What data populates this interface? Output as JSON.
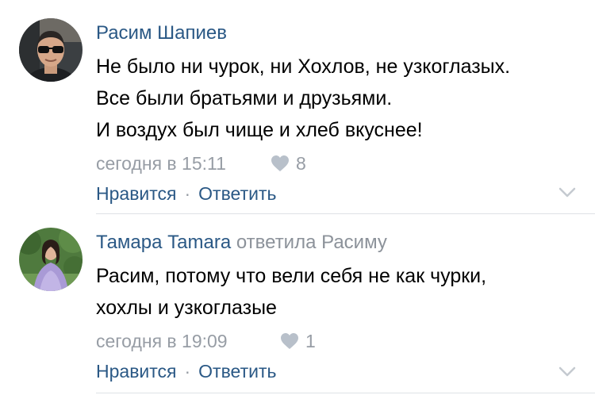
{
  "colors": {
    "link": "#2a5885",
    "meta": "#979da5",
    "text": "#000000",
    "divider": "#dfe2e6"
  },
  "comments": [
    {
      "author": "Расим Шапиев",
      "reply_to": null,
      "lines": [
        "Не было ни чурок, ни Хохлов, не узкоглазых.",
        "Все были братьями и друзьями.",
        "И воздух был чище и хлеб вкуснее!"
      ],
      "timestamp": "сегодня в 15:11",
      "likes": "8",
      "like_label": "Нравится",
      "reply_label": "Ответить",
      "separator": "·",
      "avatar_icon": "user-avatar-man-sunglasses",
      "more_icon": "chevron-down-icon"
    },
    {
      "author": "Тамара Tamara",
      "reply_prefix": "ответила",
      "reply_to": "Расиму",
      "lines": [
        "Расим, потому что вели себя не как чурки,",
        "хохлы и узкоглазые"
      ],
      "timestamp": "сегодня в 19:09",
      "likes": "1",
      "like_label": "Нравится",
      "reply_label": "Ответить",
      "separator": "·",
      "avatar_icon": "user-avatar-woman-dress",
      "more_icon": "chevron-down-icon"
    }
  ]
}
